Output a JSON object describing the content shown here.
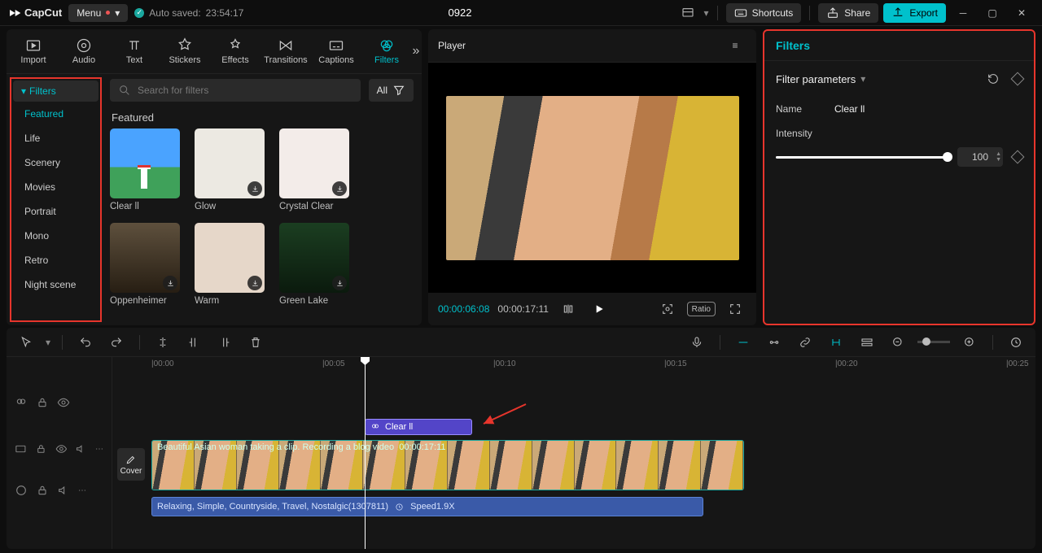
{
  "app": {
    "name": "CapCut",
    "menu_label": "Menu"
  },
  "autosave": {
    "prefix": "Auto saved:",
    "time": "23:54:17"
  },
  "project_title": "0922",
  "topbar": {
    "shortcuts": "Shortcuts",
    "share": "Share",
    "export": "Export"
  },
  "tool_tabs": [
    {
      "id": "import",
      "label": "Import"
    },
    {
      "id": "audio",
      "label": "Audio"
    },
    {
      "id": "text",
      "label": "Text"
    },
    {
      "id": "stickers",
      "label": "Stickers"
    },
    {
      "id": "effects",
      "label": "Effects"
    },
    {
      "id": "transitions",
      "label": "Transitions"
    },
    {
      "id": "captions",
      "label": "Captions"
    },
    {
      "id": "filters",
      "label": "Filters"
    }
  ],
  "sidebar": {
    "heading": "Filters",
    "items": [
      "Featured",
      "Life",
      "Scenery",
      "Movies",
      "Portrait",
      "Mono",
      "Retro",
      "Night scene"
    ]
  },
  "search": {
    "placeholder": "Search for filters",
    "all_label": "All"
  },
  "library": {
    "section": "Featured",
    "cards": [
      {
        "label": "Clear ll"
      },
      {
        "label": "Glow"
      },
      {
        "label": "Crystal Clear"
      },
      {
        "label": "Oppenheimer"
      },
      {
        "label": "Warm"
      },
      {
        "label": "Green Lake"
      }
    ]
  },
  "player": {
    "title": "Player",
    "current_tc": "00:00:06:08",
    "duration_tc": "00:00:17:11",
    "ratio_label": "Ratio"
  },
  "inspector": {
    "title": "Filters",
    "section_title": "Filter parameters",
    "name_label": "Name",
    "name_value": "Clear ll",
    "intensity_label": "Intensity",
    "intensity_value": "100"
  },
  "timeline": {
    "ruler": [
      "|00:00",
      "|00:05",
      "|00:10",
      "|00:15",
      "|00:20",
      "|00:25"
    ],
    "cover_label": "Cover",
    "filter_clip_label": "Clear ll",
    "video_clip_label": "Beautiful Asian woman taking a clip. Recording a blog video",
    "video_clip_dur": "00:00:17:11",
    "audio_clip_label": "Relaxing, Simple, Countryside, Travel, Nostalgic(1307811)",
    "audio_speed": "Speed1.9X"
  }
}
